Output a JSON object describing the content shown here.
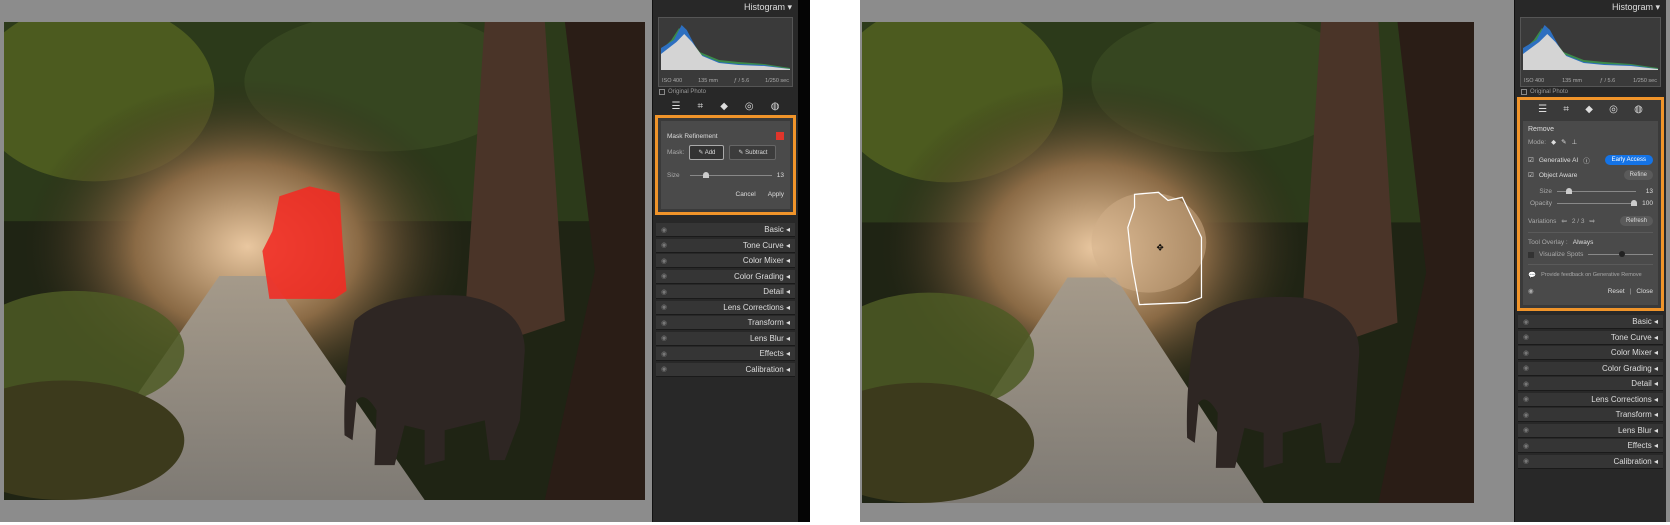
{
  "left": {
    "histogram": {
      "title": "Histogram",
      "collapse_icon": "triangle-down",
      "iso": "ISO 400",
      "focal": "135 mm",
      "aperture": "ƒ / 5.6",
      "shutter": "1/250 sec",
      "original_photo": "Original Photo"
    },
    "mask_refinement": {
      "title": "Mask Refinement",
      "overlay_color": "#e0352b",
      "mask_label": "Mask:",
      "add": "Add",
      "subtract": "Subtract",
      "size_label": "Size",
      "size_value": "13",
      "cancel": "Cancel",
      "apply": "Apply"
    }
  },
  "right": {
    "histogram": {
      "title": "Histogram",
      "iso": "ISO 400",
      "focal": "135 mm",
      "aperture": "ƒ / 5.6",
      "shutter": "1/250 sec",
      "original_photo": "Original Photo"
    },
    "remove": {
      "title": "Remove",
      "mode_label": "Mode:",
      "generative_ai": "Generative AI",
      "early_access": "Early Access",
      "object_aware": "Object Aware",
      "refine": "Refine",
      "size_label": "Size",
      "size_value": "13",
      "opacity_label": "Opacity",
      "opacity_value": "100",
      "variations_label": "Variations",
      "variations_value": "2 / 3",
      "refresh": "Refresh",
      "tool_overlay_label": "Tool Overlay :",
      "tool_overlay_value": "Always",
      "visualize_spots": "Visualize Spots",
      "feedback": "Provide feedback on Generative Remove",
      "reset": "Reset",
      "close": "Close"
    }
  },
  "sections": [
    "Basic",
    "Tone Curve",
    "Color Mixer",
    "Color Grading",
    "Detail",
    "Lens Corrections",
    "Transform",
    "Lens Blur",
    "Effects",
    "Calibration"
  ],
  "accent": "#f0942a"
}
